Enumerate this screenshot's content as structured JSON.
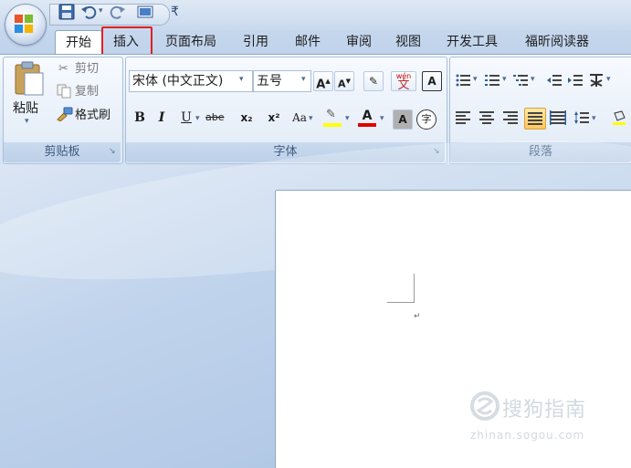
{
  "tabs": [
    "开始",
    "插入",
    "页面布局",
    "引用",
    "邮件",
    "审阅",
    "视图",
    "开发工具",
    "福昕阅读器"
  ],
  "clipboard": {
    "paste_label": "粘贴",
    "cut_label": "剪切",
    "copy_label": "复制",
    "format_painter_label": "格式刷",
    "group_label": "剪贴板"
  },
  "font": {
    "font_name": "宋体 (中文正文)",
    "font_size": "五号",
    "group_label": "字体",
    "bold": "B",
    "italic": "I",
    "underline": "U",
    "strike": "abe",
    "sub": "x₂",
    "sup": "x²",
    "case": "Aa",
    "grow": "A",
    "shrink": "A",
    "char_border": "A",
    "char_shade": "A",
    "enclose": "字",
    "phonetic": "wén",
    "phonetic_char": "文"
  },
  "paragraph": {
    "group_label": "段落"
  },
  "watermark": {
    "text": "搜狗指南",
    "sub": "zhinan.sogou.com"
  },
  "colors": {
    "highlight_red": "#e02020",
    "accent_blue": "#3d5a80"
  }
}
